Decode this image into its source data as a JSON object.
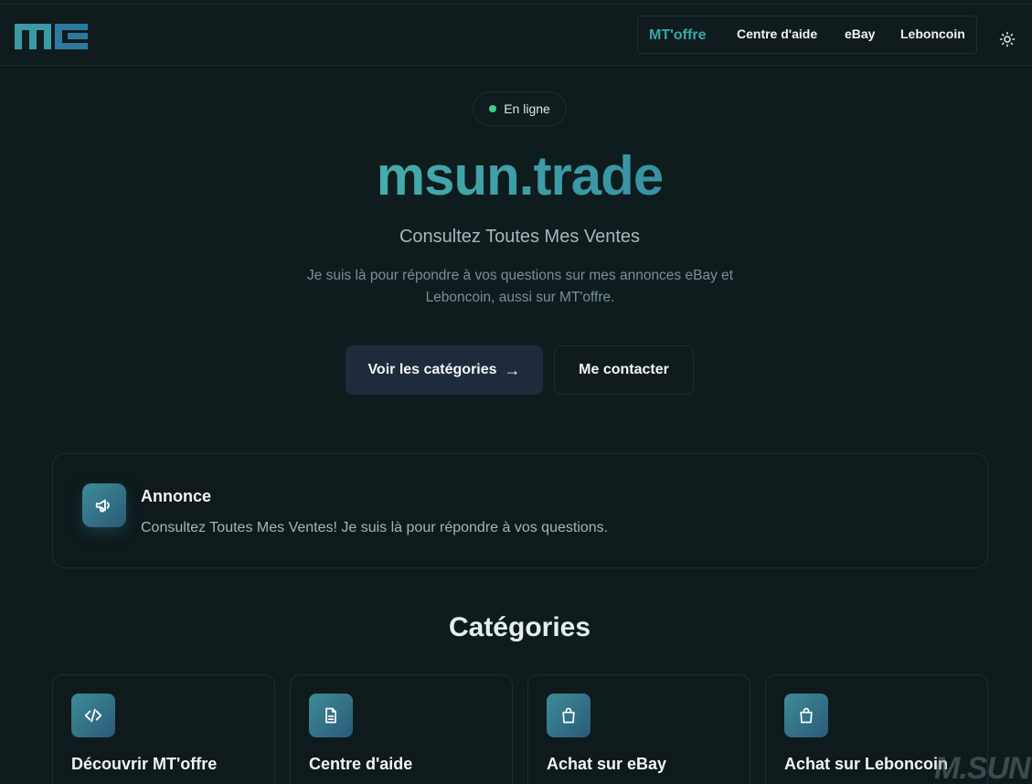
{
  "header": {
    "logo_text": "MT",
    "nav": [
      {
        "label": "MT'offre"
      },
      {
        "label": "Centre d'aide"
      },
      {
        "label": "eBay"
      },
      {
        "label": "Leboncoin"
      }
    ],
    "theme_icon": "sun-icon"
  },
  "hero": {
    "status": "En ligne",
    "title": "msun.trade",
    "subtitle": "Consultez Toutes Mes Ventes",
    "description": "Je suis là pour répondre à vos questions sur mes annonces eBay et Leboncoin, aussi sur MT'offre.",
    "primary_button": "Voir les catégories",
    "primary_arrow": "→",
    "secondary_button": "Me contacter"
  },
  "announcement": {
    "icon": "megaphone-icon",
    "title": "Annonce",
    "text": "Consultez Toutes Mes Ventes! Je suis là pour répondre à vos questions."
  },
  "categories": {
    "title": "Catégories",
    "items": [
      {
        "title": "Découvrir MT'offre",
        "icon": "code-icon"
      },
      {
        "title": "Centre d'aide",
        "icon": "document-icon"
      },
      {
        "title": "Achat sur eBay",
        "icon": "shopping-bag-icon"
      },
      {
        "title": "Achat sur Leboncoin",
        "icon": "shopping-bag-icon"
      }
    ]
  },
  "watermark": "M.SUN",
  "colors": {
    "background": "#0f1c1e",
    "accent": "#3aa6a8",
    "status_dot": "#3ecf8e",
    "primary_button": "#1f2a3c"
  }
}
